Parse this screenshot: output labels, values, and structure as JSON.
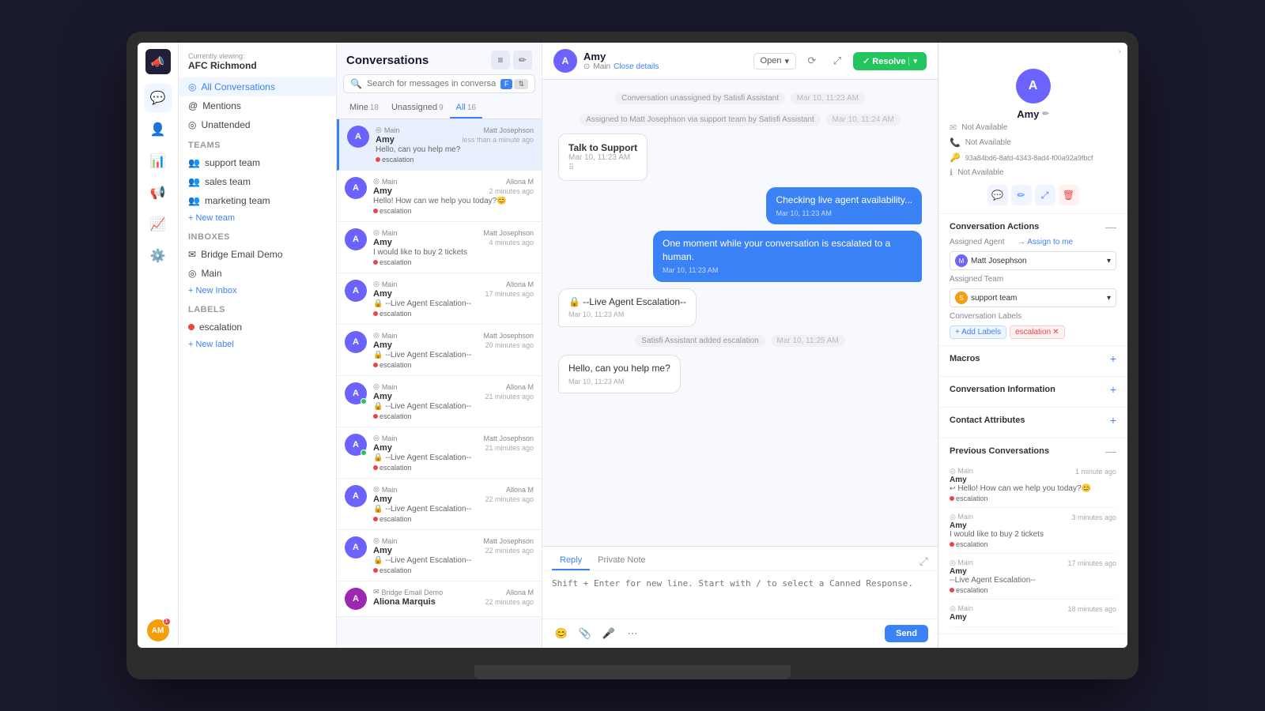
{
  "app": {
    "org": "AFC Richmond",
    "viewing_label": "Currently viewing:"
  },
  "nav": {
    "icons": [
      "🔔",
      "📊",
      "📋",
      "📈",
      "⚙️"
    ],
    "user_initials": "AM",
    "notification_count": "1"
  },
  "sidebar": {
    "conversations_header": "Conversations",
    "all_conversations": "All Conversations",
    "mentions": "Mentions",
    "unattended": "Unattended",
    "teams_title": "Teams",
    "teams": [
      "support team",
      "sales team",
      "marketing team"
    ],
    "add_team": "+ New team",
    "inboxes_title": "Inboxes",
    "inboxes": [
      "Bridge Email Demo",
      "Main"
    ],
    "add_inbox": "+ New Inbox",
    "labels_title": "Labels",
    "labels": [
      "escalation"
    ],
    "add_label": "+ New label"
  },
  "conversations": {
    "panel_title": "Conversations",
    "search_placeholder": "Search for messages in conversations",
    "open_status": "Open",
    "tabs": [
      {
        "label": "Mine",
        "count": "18",
        "active": false
      },
      {
        "label": "Unassigned",
        "count": "9",
        "active": false
      },
      {
        "label": "All",
        "count": "16",
        "active": true
      }
    ],
    "items": [
      {
        "inbox": "Main",
        "agent": "Matt Josephson",
        "time": "less than a minute ago",
        "name": "Amy",
        "preview": "Hello, can you help me?",
        "label": "escalation",
        "active": true
      },
      {
        "inbox": "Main",
        "agent": "Allona M",
        "time": "2 minutes ago",
        "name": "Amy",
        "preview": "Hello! How can we help you today?😊",
        "label": "escalation",
        "active": false
      },
      {
        "inbox": "Main",
        "agent": "Matt Josephson",
        "time": "4 minutes ago",
        "name": "Amy",
        "preview": "I would like to buy 2 tickets",
        "label": "escalation",
        "active": false
      },
      {
        "inbox": "Main",
        "agent": "Allona M",
        "time": "17 minutes ago",
        "name": "Amy",
        "preview": "--Live Agent Escalation--",
        "label": "escalation",
        "active": false
      },
      {
        "inbox": "Main",
        "agent": "Matt Josephson",
        "time": "20 minutes ago",
        "name": "Amy",
        "preview": "--Live Agent Escalation--",
        "label": "escalation",
        "active": false
      },
      {
        "inbox": "Main",
        "agent": "Allona M",
        "time": "21 minutes ago",
        "name": "Amy",
        "preview": "--Live Agent Escalation--",
        "label": "escalation",
        "active": false,
        "online": true
      },
      {
        "inbox": "Main",
        "agent": "Matt Josephson",
        "time": "21 minutes ago",
        "name": "Amy",
        "preview": "--Live Agent Escalation--",
        "label": "escalation",
        "active": false,
        "online": true
      },
      {
        "inbox": "Main",
        "agent": "Allona M",
        "time": "22 minutes ago",
        "name": "Amy",
        "preview": "--Live Agent Escalation--",
        "label": "escalation",
        "active": false
      },
      {
        "inbox": "Main",
        "agent": "Matt Josephson",
        "time": "22 minutes ago",
        "name": "Amy",
        "preview": "--Live Agent Escalation--",
        "label": "escalation",
        "active": false
      },
      {
        "inbox": "Bridge Email Demo",
        "agent": "Allona M",
        "time": "22 minutes ago",
        "name": "Aliona Marquis",
        "preview": "",
        "label": "",
        "active": false
      }
    ]
  },
  "chat": {
    "user_name": "Amy",
    "inbox": "Main",
    "close_details": "Close details",
    "open_label": "Open",
    "resolve_label": "✓ Resolve",
    "messages": [
      {
        "type": "system",
        "text": "Conversation unassigned by Satisfi Assistant",
        "time": "Mar 10, 11:23 AM"
      },
      {
        "type": "system",
        "text": "Assigned to Matt Josephson via support team by Satisfi Assistant",
        "time": "Mar 10, 11:24 AM"
      },
      {
        "type": "widget",
        "title": "Talk to Support",
        "sub": "Mar 10, 11:23 AM",
        "direction": "received"
      },
      {
        "type": "bubble",
        "text": "Checking live agent availability...",
        "time": "Mar 10, 11:23 AM",
        "direction": "sent"
      },
      {
        "type": "bubble",
        "text": "One moment while your conversation is escalated to a human.",
        "time": "Mar 10, 11:23 AM",
        "direction": "sent"
      },
      {
        "type": "bubble",
        "text": "--Live Agent Escalation--",
        "time": "Mar 10, 11:23 AM",
        "direction": "received",
        "lock": true
      },
      {
        "type": "system",
        "text": "Satisfi Assistant added escalation",
        "time": "Mar 10, 11:25 AM"
      },
      {
        "type": "bubble",
        "text": "Hello, can you help me?",
        "time": "Mar 10, 11:23 AM",
        "direction": "received"
      }
    ],
    "reply_tabs": [
      "Reply",
      "Private Note"
    ],
    "active_reply_tab": "Reply",
    "reply_placeholder": "Shift + Enter for new line. Start with / to select a Canned Response.",
    "send_label": "Send"
  },
  "right_panel": {
    "contact_name": "Amy",
    "not_available": "Not Available",
    "contact_id": "93a84bd6-8afd-4343-8ad4-f00a92a9fbcf",
    "conversation_actions_title": "Conversation Actions",
    "assigned_agent_title": "Assigned Agent",
    "assign_to_me": "→ Assign to me",
    "agent_name": "Matt Josephson",
    "assigned_team_title": "Assigned Team",
    "team_name": "support team",
    "conversation_labels_title": "Conversation Labels",
    "add_labels_btn": "+ Add Labels",
    "label_name": "escalation",
    "macros_title": "Macros",
    "conversation_info_title": "Conversation Information",
    "contact_attributes_title": "Contact Attributes",
    "previous_conversations_title": "Previous Conversations",
    "previous_conversations": [
      {
        "inbox": "Main",
        "name": "Amy",
        "preview": "Hello! How can we help you today?😊",
        "label": "escalation",
        "time": "1 minute ago"
      },
      {
        "inbox": "Main",
        "name": "Amy",
        "preview": "I would like to buy 2 tickets",
        "label": "escalation",
        "time": "3 minutes ago"
      },
      {
        "inbox": "Main",
        "name": "Amy",
        "preview": "--Live Agent Escalation--",
        "label": "escalation",
        "time": "17 minutes ago"
      },
      {
        "inbox": "Main",
        "name": "Amy",
        "preview": "",
        "label": "",
        "time": "18 minutes ago"
      }
    ]
  }
}
